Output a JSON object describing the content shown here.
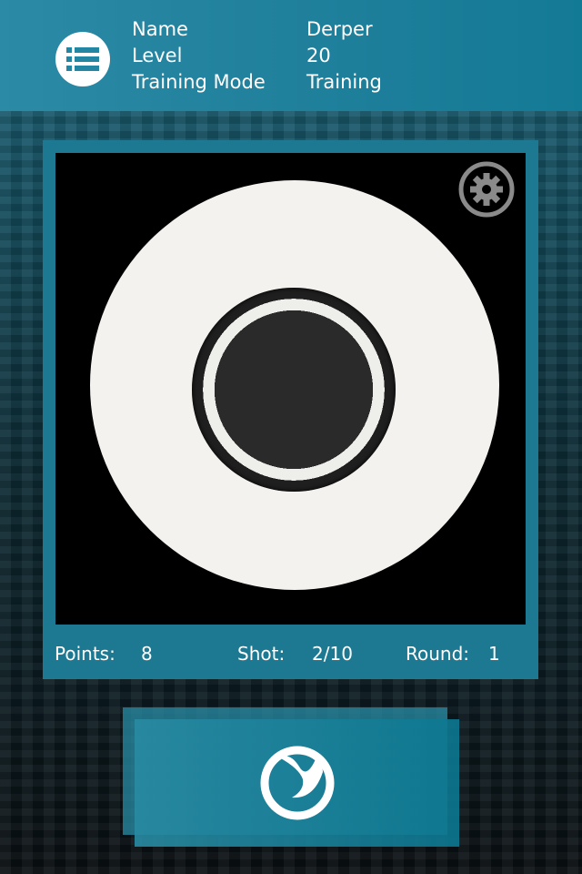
{
  "header": {
    "menu_icon": "list-icon",
    "fields": [
      {
        "label": "Name",
        "value": "Derper"
      },
      {
        "label": "Level",
        "value": "20"
      },
      {
        "label": "Training Mode",
        "value": "Training"
      }
    ]
  },
  "arena": {
    "settings_icon": "gear-icon"
  },
  "stats": {
    "points_label": "Points:",
    "points_value": "8",
    "shot_label": "Shot:",
    "shot_value": "2/10",
    "round_label": "Round:",
    "round_value": "1"
  },
  "fire_button": {
    "icon": "emblem-icon"
  },
  "colors": {
    "accent": "#1e7f9b",
    "panel": "#1d7891"
  }
}
